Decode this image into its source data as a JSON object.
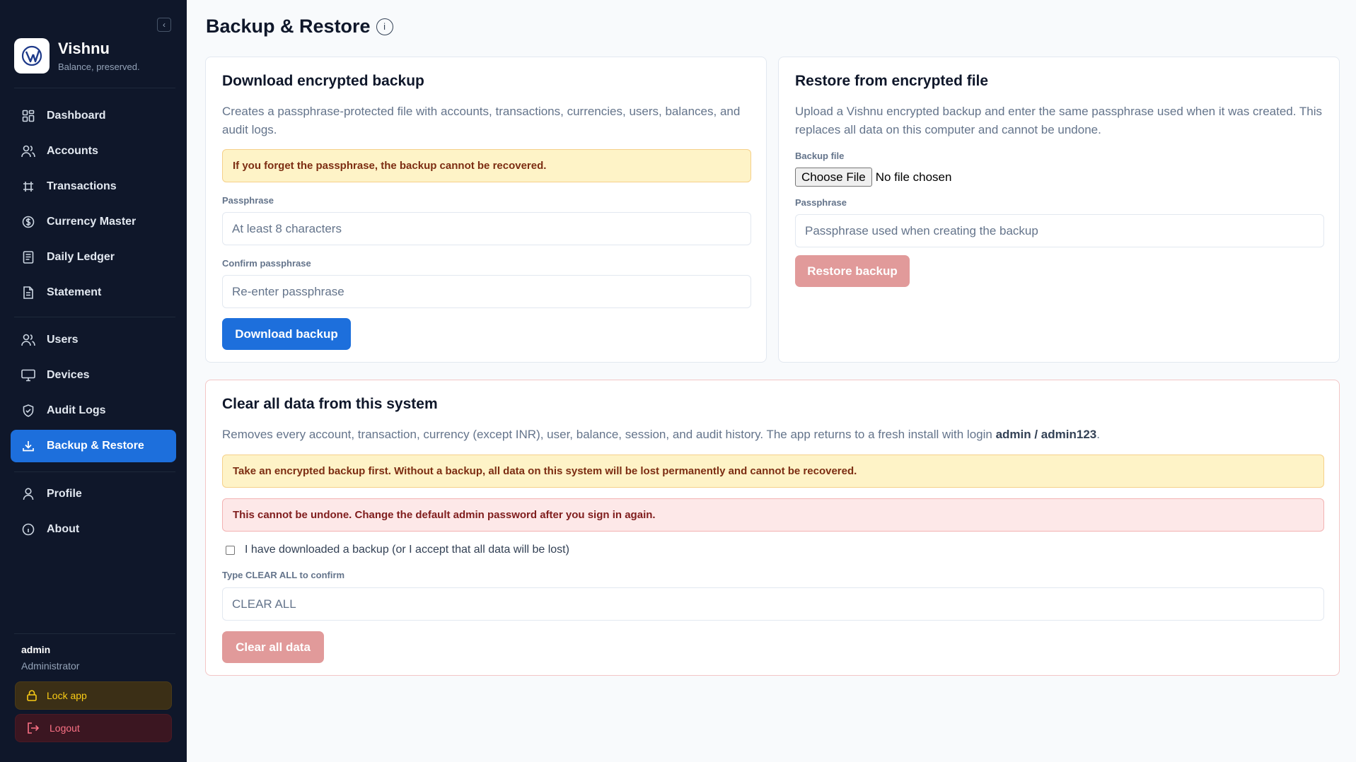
{
  "sidebar": {
    "collapse_icon": "chevron-left-icon",
    "brand": {
      "name": "Vishnu",
      "tagline": "Balance, preserved."
    },
    "nav_primary": [
      {
        "label": "Dashboard",
        "icon": "grid-icon"
      },
      {
        "label": "Accounts",
        "icon": "users-icon"
      },
      {
        "label": "Transactions",
        "icon": "transactions-icon"
      },
      {
        "label": "Currency Master",
        "icon": "currency-icon"
      },
      {
        "label": "Daily Ledger",
        "icon": "ledger-icon"
      },
      {
        "label": "Statement",
        "icon": "document-icon"
      }
    ],
    "nav_admin": [
      {
        "label": "Users",
        "icon": "users-icon"
      },
      {
        "label": "Devices",
        "icon": "monitor-icon"
      },
      {
        "label": "Audit Logs",
        "icon": "shield-icon"
      },
      {
        "label": "Backup & Restore",
        "icon": "download-icon",
        "active": true
      }
    ],
    "nav_footer": [
      {
        "label": "Profile",
        "icon": "user-icon"
      },
      {
        "label": "About",
        "icon": "info-icon"
      }
    ],
    "user": {
      "name": "admin",
      "role": "Administrator"
    },
    "lock_label": "Lock app",
    "logout_label": "Logout"
  },
  "page": {
    "title": "Backup & Restore"
  },
  "download_card": {
    "title": "Download encrypted backup",
    "description": "Creates a passphrase-protected file with accounts, transactions, currencies, users, balances, and audit logs.",
    "warning": "If you forget the passphrase, the backup cannot be recovered.",
    "passphrase_label": "Passphrase",
    "passphrase_placeholder": "At least 8 characters",
    "confirm_label": "Confirm passphrase",
    "confirm_placeholder": "Re-enter passphrase",
    "button": "Download backup"
  },
  "restore_card": {
    "title": "Restore from encrypted file",
    "description": "Upload a Vishnu encrypted backup and enter the same passphrase used when it was created. This replaces all data on this computer and cannot be undone.",
    "file_label": "Backup file",
    "choose_file": "Choose File",
    "no_file": "No file chosen",
    "passphrase_label": "Passphrase",
    "passphrase_placeholder": "Passphrase used when creating the backup",
    "button": "Restore backup"
  },
  "clear_card": {
    "title": "Clear all data from this system",
    "description": "Removes every account, transaction, currency (except INR), user, balance, session, and audit history. The app returns to a fresh install with login ",
    "credentials": "admin / admin123",
    "description_end": ".",
    "warning": "Take an encrypted backup first. Without a backup, all data on this system will be lost permanently and cannot be recovered.",
    "danger": "This cannot be undone. Change the default admin password after you sign in again.",
    "checkbox_label": "I have downloaded a backup (or I accept that all data will be lost)",
    "confirm_label": "Type CLEAR ALL to confirm",
    "confirm_placeholder": "CLEAR ALL",
    "button": "Clear all data"
  },
  "colors": {
    "sidebar": "#0f172a",
    "accent": "#1d6fdc",
    "danger_muted": "#e19a9a",
    "warn_bg": "#fef3c7",
    "danger_bg": "#fde8e8"
  }
}
